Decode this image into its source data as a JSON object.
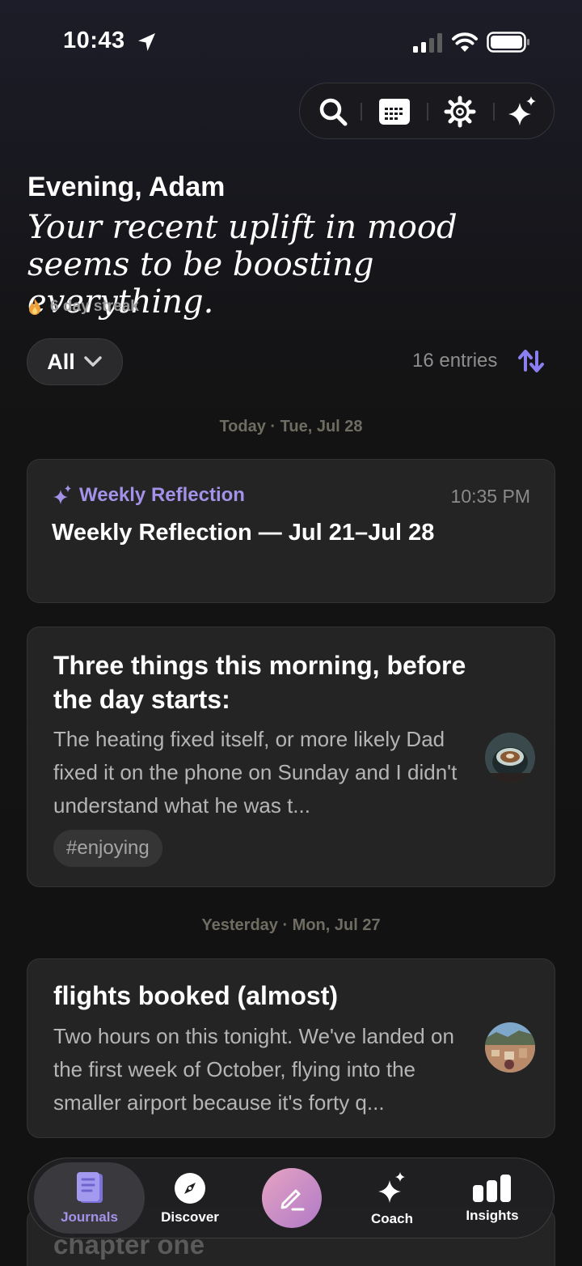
{
  "status_bar": {
    "time": "10:43"
  },
  "toolbar": {
    "icons": [
      "search-icon",
      "calendar-icon",
      "gear-icon",
      "sparkles-icon"
    ]
  },
  "header": {
    "greeting": "Evening, Adam",
    "insight": "Your recent uplift in mood seems to be boosting everything.",
    "streak": "6 day streak"
  },
  "filter": {
    "label": "All",
    "entries_count": "16 entries"
  },
  "sections": {
    "today": "Today · Tue, Jul 28",
    "yesterday": "Yesterday · Mon, Jul 27"
  },
  "entries": [
    {
      "tag": "Weekly Reflection",
      "time": "10:35 PM",
      "title": "Weekly Reflection — Jul 21–Jul 28"
    },
    {
      "title": "Three things this morning, before the day starts:",
      "body": "The heating fixed itself, or more likely Dad fixed it on the phone on Sunday and I didn't understand what he was t...",
      "hashtag": "#enjoying"
    },
    {
      "title": "flights booked (almost)",
      "body": "Two hours on this tonight. We've landed on the first week of October, flying into the smaller airport because it's forty q..."
    },
    {
      "title": "chapter one"
    }
  ],
  "nav": {
    "journals": "Journals",
    "discover": "Discover",
    "coach": "Coach",
    "insights": "Insights"
  },
  "colors": {
    "accent": "#a392e8",
    "sort_accent": "#8b7ef0",
    "compose_gradient_start": "#e6a3c2",
    "compose_gradient_end": "#b07ac8"
  }
}
